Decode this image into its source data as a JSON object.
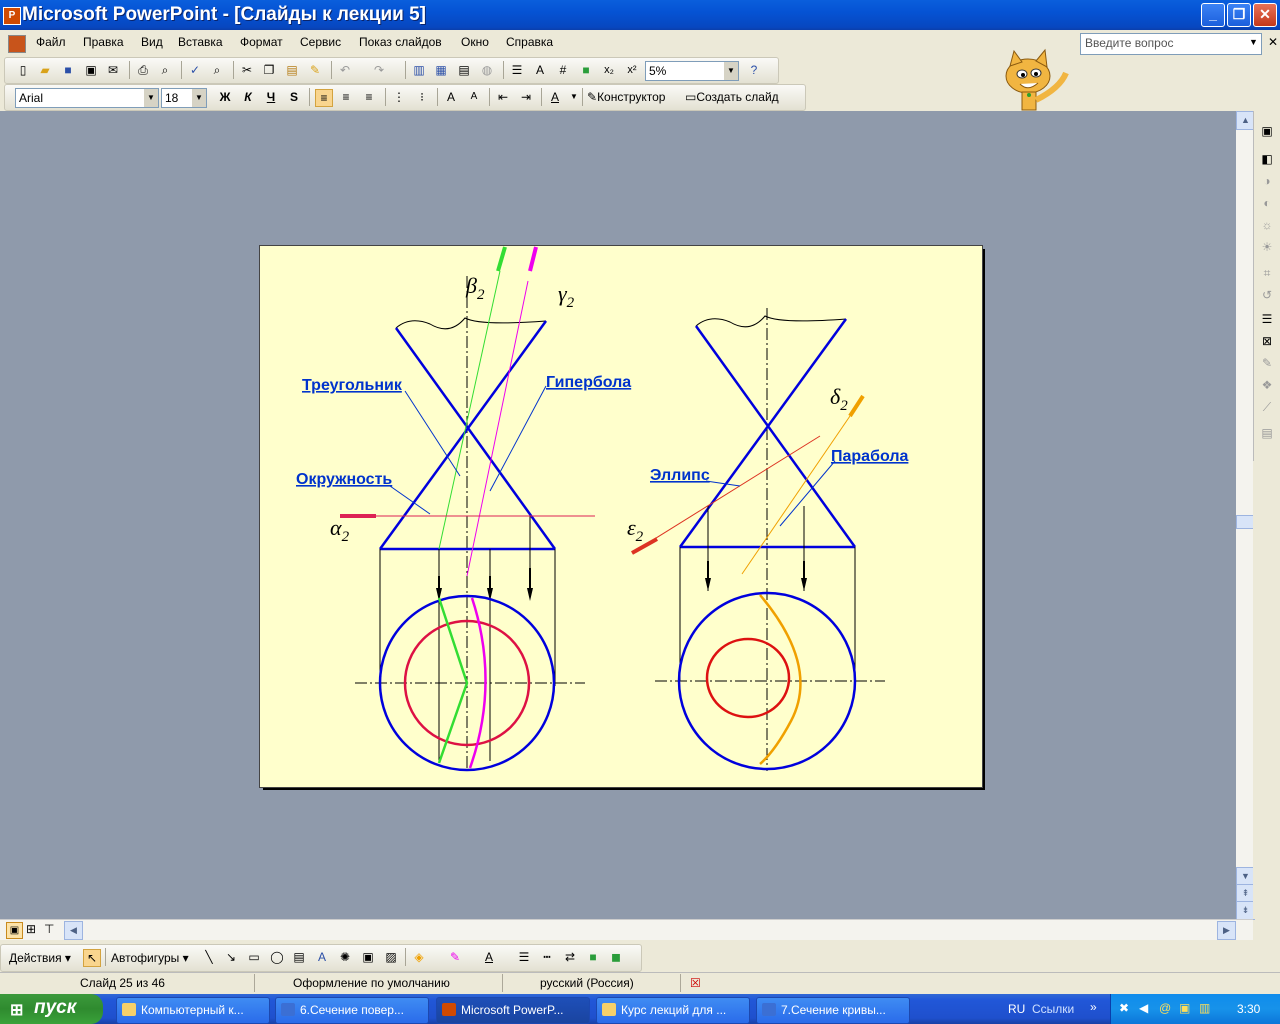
{
  "window": {
    "title": "Microsoft PowerPoint - [Слайды к лекции 5]",
    "icon_text": "P"
  },
  "menu": [
    "Файл",
    "Правка",
    "Вид",
    "Вставка",
    "Формат",
    "Сервис",
    "Показ слайдов",
    "Окно",
    "Справка"
  ],
  "help_search": {
    "placeholder": "Введите вопрос"
  },
  "standard_toolbar": {
    "zoom": "5%"
  },
  "format_toolbar": {
    "font": "Arial",
    "size": "18",
    "bold": "Ж",
    "italic": "К",
    "underline": "Ч",
    "shadow": "S",
    "designer": "Конструктор",
    "new_slide": "Создать слайд"
  },
  "slide": {
    "left": {
      "beta": "β",
      "beta_sub": "2",
      "gamma": "γ",
      "gamma_sub": "2",
      "alpha": "α",
      "alpha_sub": "2",
      "label_triangle": "Треугольник",
      "label_hyperbola": "Гипербола",
      "label_circle": "Окружность"
    },
    "right": {
      "delta": "δ",
      "delta_sub": "2",
      "epsilon": "ε",
      "epsilon_sub": "2",
      "label_ellipse": "Эллипс",
      "label_parabola": "Парабола"
    }
  },
  "drawing_toolbar": {
    "actions": "Действия",
    "autoshapes": "Автофигуры"
  },
  "status": {
    "slide_counter": "Слайд 25 из 46",
    "design": "Оформление по умолчанию",
    "language": "русский (Россия)"
  },
  "taskbar": {
    "start": "пуск",
    "tasks": [
      "Компьютерный к...",
      "6.Сечение повер...",
      "Microsoft PowerP...",
      "Курс лекций для ...",
      "7.Сечение кривы..."
    ],
    "lang": "RU",
    "links": "Ссылки",
    "clock": "3:30"
  }
}
